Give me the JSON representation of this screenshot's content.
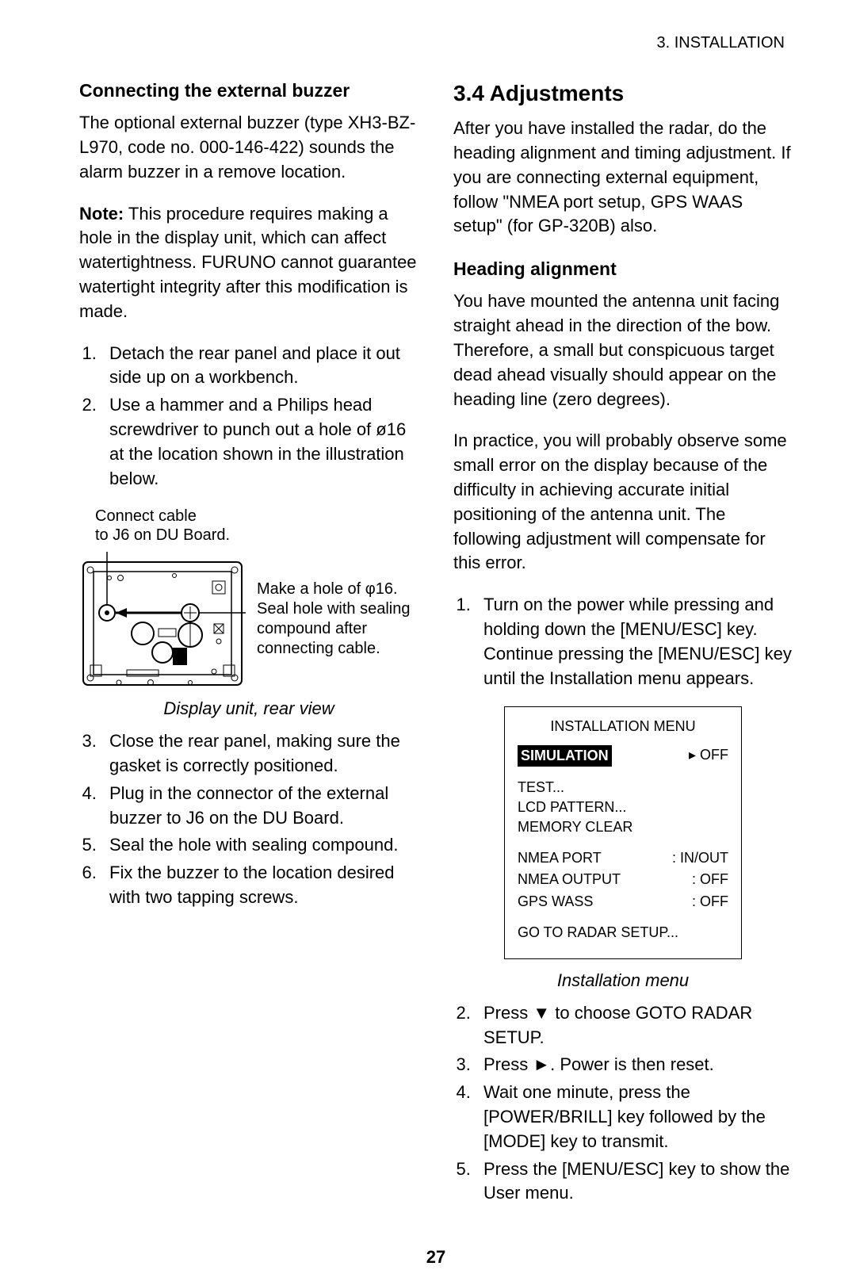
{
  "header": {
    "chapter": "3.  INSTALLATION"
  },
  "left": {
    "h_buzzer": "Connecting the external buzzer",
    "p1": "The optional external buzzer (type XH3-BZ-L970, code no. 000-146-422) sounds the alarm buzzer in a remove location.",
    "note_label": "Note:",
    "note_text": " This procedure requires making a hole in the display unit, which can affect watertightness. FURUNO cannot guarantee watertight integrity after this modification is made.",
    "steps_a": {
      "s1": "Detach the rear panel and place it out side up on a workbench.",
      "s2": "Use a hammer and a Philips head screwdriver to punch out a hole of ø16 at the location shown in the illustration below."
    },
    "fig": {
      "label_top": "Connect cable\nto J6 on DU Board.",
      "side_note": "Make a hole of φ16. Seal hole with sealing compound after connecting cable.",
      "caption": "Display unit, rear view"
    },
    "steps_b": {
      "s3": "Close the rear panel, making sure the gasket is correctly positioned.",
      "s4": "Plug in the connector of the external buzzer to J6 on the DU Board.",
      "s5": "Seal the hole with sealing compound.",
      "s6": "Fix the buzzer to the location desired with two tapping screws."
    }
  },
  "right": {
    "h_section": "3.4  Adjustments",
    "p1": "After you have installed the radar, do the heading alignment and timing adjustment. If you are connecting external equipment, follow \"NMEA port setup, GPS WAAS setup\" (for GP-320B) also.",
    "h_heading": "Heading alignment",
    "p2": "You have mounted the antenna unit facing straight ahead in the direction of the bow. Therefore, a small but conspicuous target dead ahead visually should appear on the heading line (zero degrees).",
    "p3": "In practice, you will probably observe some small error on the display because of the difficulty in achieving accurate initial positioning of the antenna unit. The following adjustment will compensate for this error.",
    "steps_a": {
      "s1": "Turn on the power while pressing and holding down the [MENU/ESC] key. Continue pressing the [MENU/ESC] key until the Installation menu appears."
    },
    "menu": {
      "title": "INSTALLATION MENU",
      "sim_label": "SIMULATION",
      "sim_val": "▸ OFF",
      "items1": [
        "TEST...",
        "LCD PATTERN...",
        "MEMORY CLEAR"
      ],
      "items2": [
        {
          "label": "NMEA PORT",
          "val": ": IN/OUT"
        },
        {
          "label": "NMEA OUTPUT",
          "val": ": OFF"
        },
        {
          "label": "GPS WASS",
          "val": ": OFF"
        }
      ],
      "footer": "GO TO RADAR SETUP...",
      "caption": "Installation menu"
    },
    "steps_b": {
      "s2": "Press ▼ to choose GOTO RADAR SETUP.",
      "s3": "Press ►. Power is then reset.",
      "s4": "Wait one minute, press the [POWER/BRILL] key followed by the [MODE] key to transmit.",
      "s5": "Press the [MENU/ESC] key to show the User menu."
    }
  },
  "page": "27"
}
